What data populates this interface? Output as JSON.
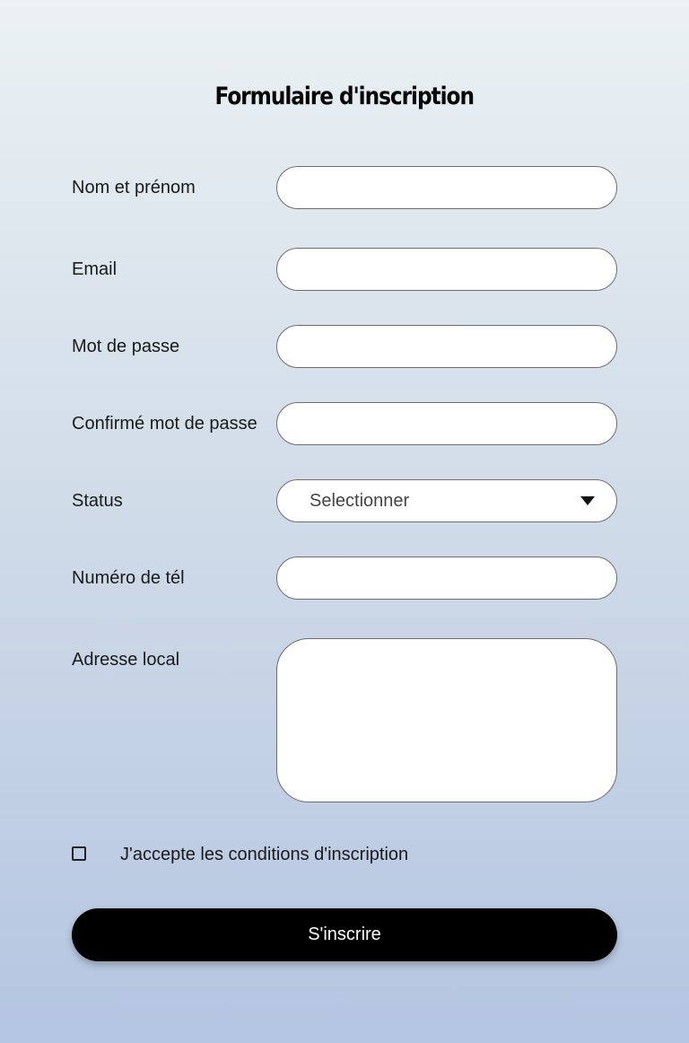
{
  "form": {
    "title": "Formulaire d'inscription",
    "fields": {
      "fullname": {
        "label": "Nom et prénom",
        "value": ""
      },
      "email": {
        "label": "Email",
        "value": ""
      },
      "password": {
        "label": "Mot de passe",
        "value": ""
      },
      "confirm_password": {
        "label": "Confirmé mot de passe",
        "value": ""
      },
      "status": {
        "label": "Status",
        "selected": "Selectionner"
      },
      "phone": {
        "label": "Numéro de tél",
        "value": ""
      },
      "address": {
        "label": "Adresse local",
        "value": ""
      }
    },
    "terms_label": "J'accepte les conditions d'inscription",
    "terms_checked": false,
    "submit_label": "S'inscrire"
  },
  "icons": {
    "status_dropdown": "caret-down-icon"
  },
  "colors": {
    "background_top": "#ebf1f4",
    "background_bottom": "#b4c5e1",
    "button": "#000000",
    "button_text": "#ffffff",
    "field_border": "#6d6d6d"
  }
}
